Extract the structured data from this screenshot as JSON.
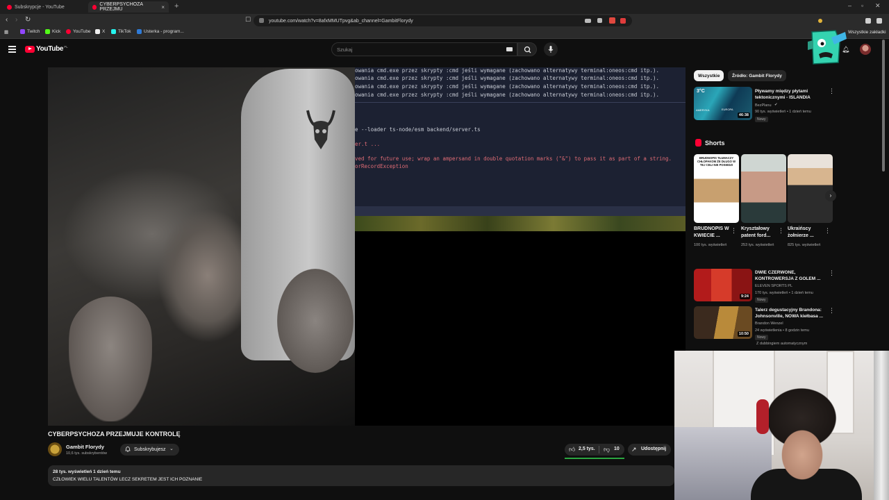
{
  "browser": {
    "tabs": [
      {
        "title": "Subskrypcje - YouTube",
        "active": false
      },
      {
        "title": "CYBERPSYCHOZA PRZEJMU",
        "active": true
      }
    ],
    "new_tab": "+",
    "url": "youtube.com/watch?v=8afxMMUTpvg&ab_channel=GambitFlorydy",
    "all_bookmarks": "Wszystkie zakładki",
    "bookmarks": [
      {
        "label": "Twitch",
        "color": "#9146ff"
      },
      {
        "label": "Kick",
        "color": "#53fc18"
      },
      {
        "label": "YouTube",
        "color": "#ff0033"
      },
      {
        "label": "X",
        "color": "#ffffff"
      },
      {
        "label": "TikTok",
        "color": "#25f4ee"
      },
      {
        "label": "Usterka - program...",
        "color": "#2f7bd8"
      }
    ]
  },
  "youtube": {
    "logo_text": "YouTube",
    "logo_country": "PL",
    "search_placeholder": "Szukaj",
    "accent": "#ff0033"
  },
  "terminal": {
    "lines": [
      {
        "text": "owania cmd.exe przez skrypty :cmd jeśli wymagane (zachowano alternatywy terminal:oneos:cmd itp.).",
        "err": false
      },
      {
        "text": "owania cmd.exe przez skrypty :cmd jeśli wymagane (zachowano alternatywy terminal:oneos:cmd itp.).",
        "err": false
      },
      {
        "text": "owania cmd.exe przez skrypty :cmd jeśli wymagane (zachowano alternatywy terminal:oneos:cmd itp.).",
        "err": false
      },
      {
        "text": "owania cmd.exe przez skrypty :cmd jeśli wymagane (zachowano alternatywy terminal:oneos:cmd itp.).",
        "err": false
      },
      {
        "text": "e --loader ts-node/esm backend/server.ts",
        "err": false
      },
      {
        "text": "er.t ...",
        "err": true
      },
      {
        "text": "ved for future use; wrap an ampersand in double quotation marks (\"&\") to pass it as part of a string.",
        "err": true
      },
      {
        "text": "orRecordException",
        "err": true
      }
    ]
  },
  "video": {
    "title": "CYBERPSYCHOZA PRZEJMUJE KONTROLĘ",
    "channel_name": "Gambit Florydy",
    "channel_subs": "10,6 tys. subskrybentów",
    "subscribe_label": "Subskrybujesz",
    "likes": "2,5 tys.",
    "dislikes": "10",
    "share_label": "Udostępnij",
    "like_ratio_color": "#2ba640",
    "stats": "28 tys. wyświetleń  1 dzień temu",
    "description": "CZŁOWIEK WIELU TALENTÓW LECZ SEKRETEM JEST ICH POZNANIE"
  },
  "sidebar": {
    "chips": [
      "Wszystkie",
      "Źródło: Gambit Florydy"
    ],
    "videos": [
      {
        "title": "Pływamy między płytami tektonicznymi - ISLANDIA",
        "channel": "BezPlanu",
        "meta": "90 tys. wyświetleń • 1 dzień temu",
        "badge": "Nowy",
        "duration": "46:38",
        "verified": true
      },
      {
        "title": "DWIE CZERWONE, KONTROWERSJA Z GOLEM ...",
        "channel": "ELEVEN SPORTS PL",
        "meta": "170 tys. wyświetleń • 1 dzień temu",
        "badge": "Nowy",
        "duration": "9:24"
      },
      {
        "title": "Talerz degustacyjny Brandona: Johnsonville, NOWA kiełbasa ...",
        "channel": "Brandon Wenzel",
        "meta": "24 wyświetlenia • 8 godzin temu",
        "badge": "Nowy",
        "duration": "10:50",
        "dubbing": "Z dubbingiem automatycznym"
      }
    ],
    "thumb1_overlay": {
      "a": "3°C",
      "b": "AMERYKA",
      "c": "EUROPA"
    },
    "shorts_label": "Shorts",
    "shorts": [
      {
        "title": "BRUDNOPIS W KWIECIE ...",
        "meta": "100 tys. wyświetleń",
        "overlay": "BRUDNOPIS TŁUMACZY CHŁOPAKOM ŻE DŁUGO W TEJ CELI NIE POSIEDZI"
      },
      {
        "title": "Kryształowy patent ford...",
        "meta": "253 tys. wyświetleń"
      },
      {
        "title": "Ukraińscy żołnierze ...",
        "meta": "825 tys. wyświetleń"
      }
    ],
    "shorts_next": "›"
  },
  "icons": {
    "back": "‹",
    "forward": "›",
    "reload": "↻",
    "kebab": "⋮",
    "like": "👍︎",
    "dislike": "👎︎",
    "share": "↗"
  }
}
